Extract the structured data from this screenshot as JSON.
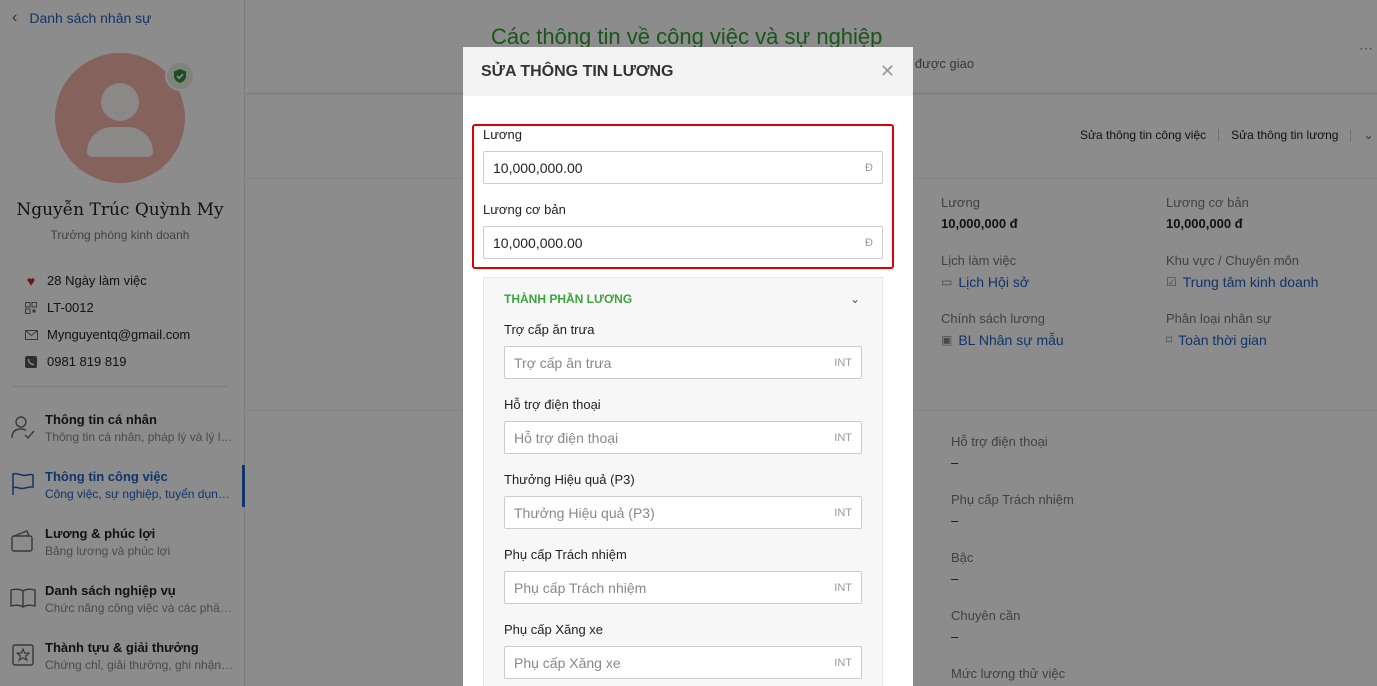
{
  "sidebar": {
    "back_label": "Danh sách nhân sự",
    "name": "Nguyễn Trúc Quỳnh My",
    "role": "Trưởng phòng kinh doanh",
    "work_days": "28 Ngày làm việc",
    "code": "LT-0012",
    "email": "Mynguyentq@gmail.com",
    "phone": "0981 819 819",
    "menu": [
      {
        "title": "Thông tin cá nhân",
        "sub": "Thông tin cá nhân, pháp lý và lý lịch"
      },
      {
        "title": "Thông tin công việc",
        "sub": "Công việc, sự nghiệp, tuyển dụng ..."
      },
      {
        "title": "Lương & phúc lợi",
        "sub": "Bảng lương và phúc lợi"
      },
      {
        "title": "Danh sách nghiệp vụ",
        "sub": "Chức năng công việc và các phần..."
      },
      {
        "title": "Thành tựu & giải thưởng",
        "sub": "Chứng chỉ, giải thưởng, ghi nhận v..."
      }
    ]
  },
  "main": {
    "title": "Các thông tin về công việc và sự nghiệp",
    "subtitle": "...ệu được giao",
    "actions": [
      "Sửa thông tin công việc",
      "Sửa thông tin lương"
    ],
    "fields": {
      "salary_label": "Lương",
      "salary_value": "10,000,000 đ",
      "base_label": "Lương cơ bản",
      "base_value": "10,000,000 đ",
      "schedule_label": "Lịch làm việc",
      "schedule_value": "Lịch Hội sở",
      "area_label": "Khu vực / Chuyên môn",
      "area_value": "Trung tâm kinh doanh",
      "policy_label": "Chính sách lương",
      "policy_value": "BL Nhân sự mẫu",
      "type_label": "Phân loại nhân sự",
      "type_value": "Toàn thời gian"
    },
    "allowances": [
      {
        "label": "Hỗ trợ điện thoại",
        "value": "–"
      },
      {
        "label": "Phụ cấp Trách nhiệm",
        "value": "–"
      },
      {
        "label": "Bậc",
        "value": "–"
      },
      {
        "label": "Chuyên cần",
        "value": "–"
      },
      {
        "label": "Mức lương thử việc",
        "value": ""
      }
    ]
  },
  "modal": {
    "title": "SỬA THÔNG TIN LƯƠNG",
    "salary": {
      "label": "Lương",
      "value": "10,000,000.00",
      "suffix": "Đ"
    },
    "base_salary": {
      "label": "Lương cơ bản",
      "value": "10,000,000.00",
      "suffix": "Đ"
    },
    "components_title": "THÀNH PHẦN LƯƠNG",
    "components": [
      {
        "label": "Trợ cấp ăn trưa",
        "placeholder": "Trợ cấp ăn trưa",
        "suffix": "INT"
      },
      {
        "label": "Hỗ trợ điện thoại",
        "placeholder": "Hỗ trợ điện thoại",
        "suffix": "INT"
      },
      {
        "label": "Thưởng Hiệu quả (P3)",
        "placeholder": "Thưởng Hiệu quả (P3)",
        "suffix": "INT"
      },
      {
        "label": "Phụ cấp Trách nhiệm",
        "placeholder": "Phụ cấp Trách nhiệm",
        "suffix": "INT"
      },
      {
        "label": "Phụ cấp Xăng xe",
        "placeholder": "Phụ cấp Xăng xe",
        "suffix": "INT"
      }
    ]
  }
}
